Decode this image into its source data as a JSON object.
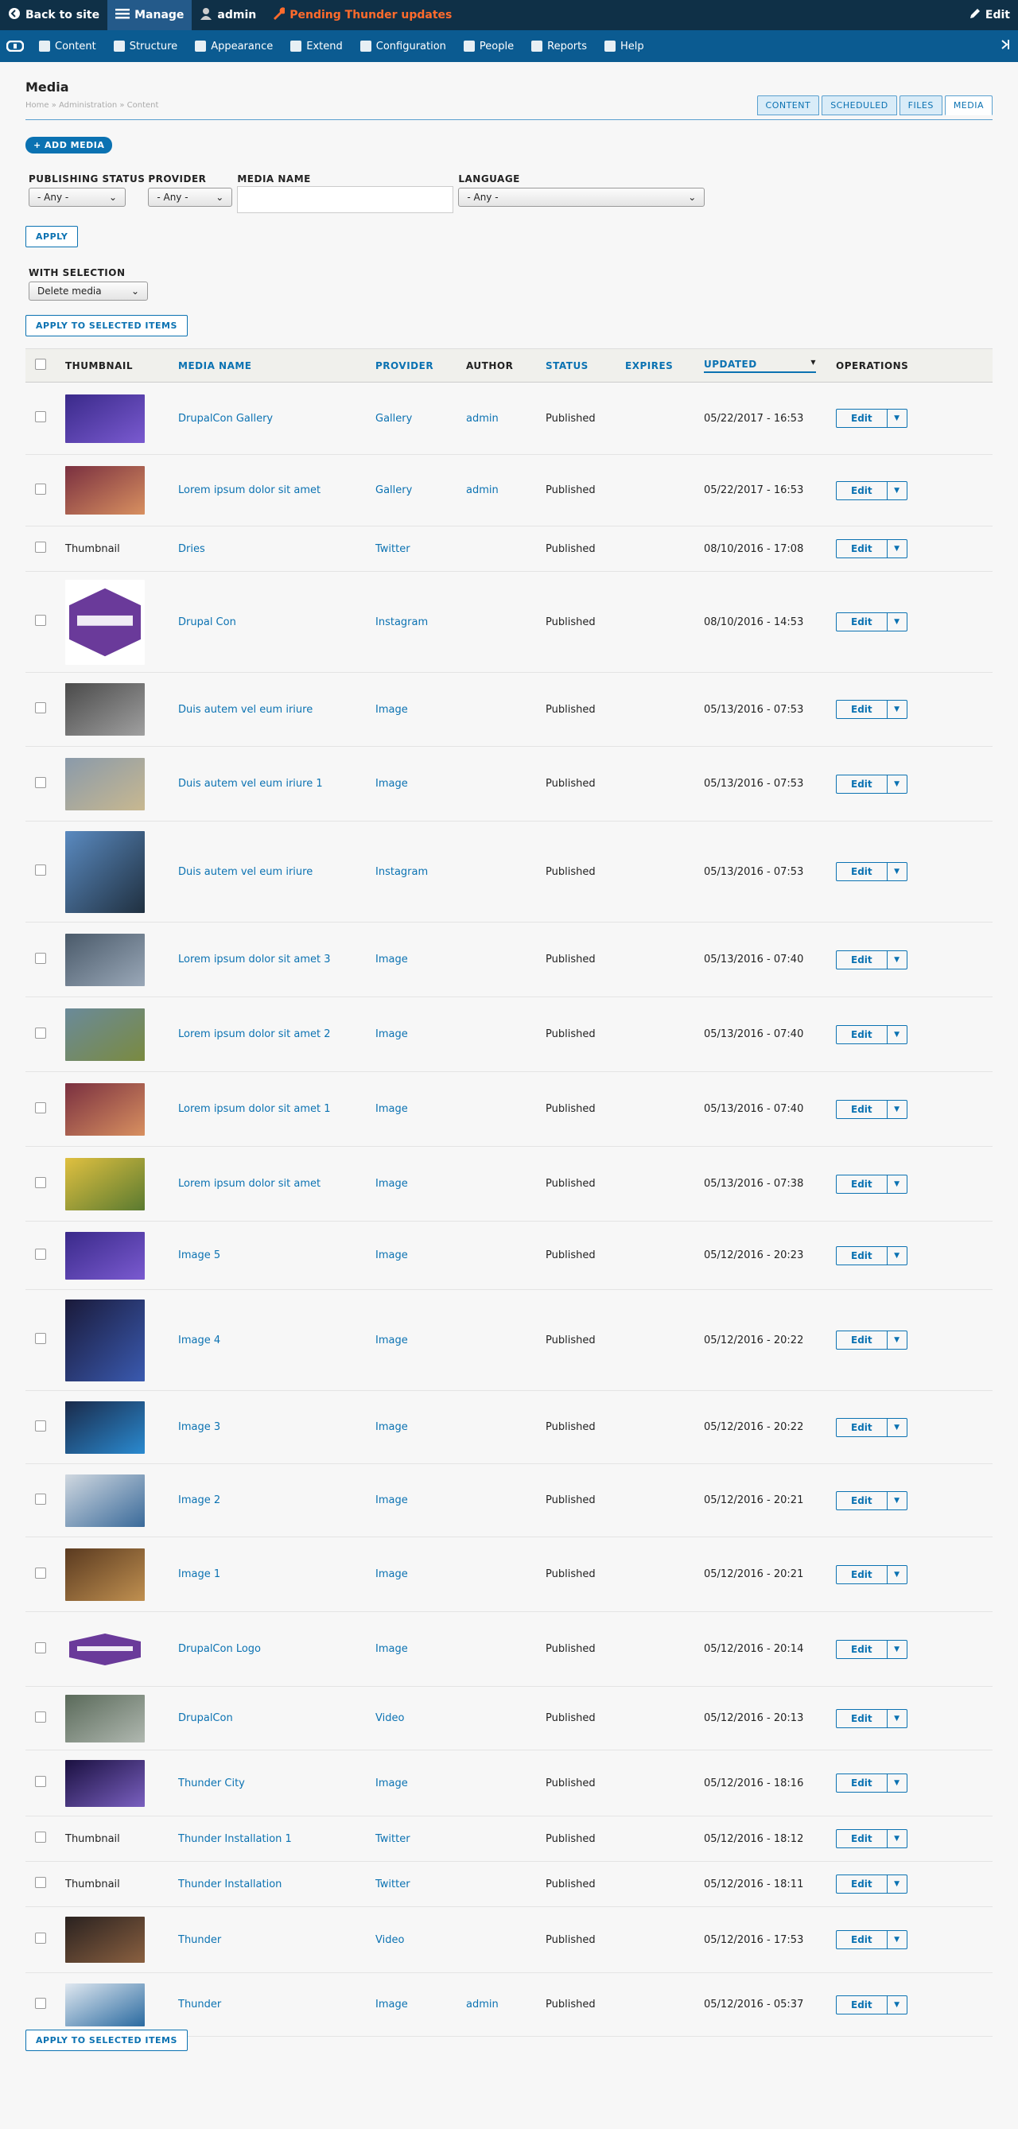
{
  "toolbar": {
    "back_label": "Back to site",
    "manage_label": "Manage",
    "user_label": "admin",
    "pending_label": "Pending Thunder updates",
    "edit_label": "Edit"
  },
  "admin_menu": {
    "items": [
      {
        "label": "Content",
        "icon": "content-icon"
      },
      {
        "label": "Structure",
        "icon": "structure-icon"
      },
      {
        "label": "Appearance",
        "icon": "appearance-icon"
      },
      {
        "label": "Extend",
        "icon": "extend-icon"
      },
      {
        "label": "Configuration",
        "icon": "configuration-icon"
      },
      {
        "label": "People",
        "icon": "people-icon"
      },
      {
        "label": "Reports",
        "icon": "reports-icon"
      },
      {
        "label": "Help",
        "icon": "help-icon"
      }
    ]
  },
  "page": {
    "title": "Media",
    "breadcrumb": "Home » Administration » Content",
    "tabs": [
      "CONTENT",
      "SCHEDULED",
      "FILES",
      "MEDIA"
    ],
    "active_tab": "MEDIA",
    "add_button": "+ ADD MEDIA"
  },
  "filters": {
    "publishing_status": {
      "label": "PUBLISHING STATUS",
      "value": "- Any -"
    },
    "provider": {
      "label": "PROVIDER",
      "value": "- Any -"
    },
    "media_name": {
      "label": "MEDIA NAME",
      "value": ""
    },
    "language": {
      "label": "LANGUAGE",
      "value": "- Any -"
    },
    "apply_label": "APPLY"
  },
  "bulk": {
    "label": "WITH SELECTION",
    "action": "Delete media",
    "apply_label": "APPLY TO SELECTED ITEMS"
  },
  "table": {
    "headers": {
      "thumbnail": "THUMBNAIL",
      "name": "MEDIA NAME",
      "provider": "PROVIDER",
      "author": "AUTHOR",
      "status": "STATUS",
      "expires": "EXPIRES",
      "updated": "UPDATED",
      "operations": "OPERATIONS"
    },
    "edit_label": "Edit",
    "rows": [
      {
        "thumb": "image",
        "thumb_text": "",
        "colors": [
          "#3a2a8a",
          "#7a5ad0"
        ],
        "name": "DrupalCon Gallery",
        "provider": "Gallery",
        "author": "admin",
        "status": "Published",
        "updated": "05/22/2017 - 16:53"
      },
      {
        "thumb": "image",
        "thumb_text": "",
        "colors": [
          "#7a3040",
          "#d89060"
        ],
        "name": "Lorem ipsum dolor sit amet",
        "provider": "Gallery",
        "author": "admin",
        "status": "Published",
        "updated": "05/22/2017 - 16:53"
      },
      {
        "thumb": "text",
        "thumb_text": "Thumbnail",
        "colors": [],
        "name": "Dries",
        "provider": "Twitter",
        "author": "",
        "status": "Published",
        "updated": "08/10/2016 - 17:08"
      },
      {
        "thumb": "logo",
        "thumb_text": "",
        "colors": [
          "#ffffff",
          "#6a3a9a"
        ],
        "name": "Drupal Con",
        "provider": "Instagram",
        "author": "",
        "status": "Published",
        "updated": "08/10/2016 - 14:53"
      },
      {
        "thumb": "image",
        "thumb_text": "",
        "colors": [
          "#4a4a4a",
          "#a0a0a0"
        ],
        "name": "Duis autem vel eum iriure",
        "provider": "Image",
        "author": "",
        "status": "Published",
        "updated": "05/13/2016 - 07:53"
      },
      {
        "thumb": "image",
        "thumb_text": "",
        "colors": [
          "#8a9aaa",
          "#c8b890"
        ],
        "name": "Duis autem vel eum iriure 1",
        "provider": "Image",
        "author": "",
        "status": "Published",
        "updated": "05/13/2016 - 07:53"
      },
      {
        "thumb": "image",
        "thumb_text": "",
        "colors": [
          "#5a8ac0",
          "#203040"
        ],
        "name": "Duis autem vel eum iriure",
        "provider": "Instagram",
        "author": "",
        "status": "Published",
        "updated": "05/13/2016 - 07:53"
      },
      {
        "thumb": "image",
        "thumb_text": "",
        "colors": [
          "#4a5a6a",
          "#9aa8b8"
        ],
        "name": "Lorem ipsum dolor sit amet 3",
        "provider": "Image",
        "author": "",
        "status": "Published",
        "updated": "05/13/2016 - 07:40"
      },
      {
        "thumb": "image",
        "thumb_text": "",
        "colors": [
          "#6a8a9a",
          "#7a8a40"
        ],
        "name": "Lorem ipsum dolor sit amet 2",
        "provider": "Image",
        "author": "",
        "status": "Published",
        "updated": "05/13/2016 - 07:40"
      },
      {
        "thumb": "image",
        "thumb_text": "",
        "colors": [
          "#7a3040",
          "#d89060"
        ],
        "name": "Lorem ipsum dolor sit amet 1",
        "provider": "Image",
        "author": "",
        "status": "Published",
        "updated": "05/13/2016 - 07:40"
      },
      {
        "thumb": "image",
        "thumb_text": "",
        "colors": [
          "#e0c040",
          "#5a7a30"
        ],
        "name": "Lorem ipsum dolor sit amet",
        "provider": "Image",
        "author": "",
        "status": "Published",
        "updated": "05/13/2016 - 07:38"
      },
      {
        "thumb": "image",
        "thumb_text": "",
        "colors": [
          "#3a2a8a",
          "#7a5ad0"
        ],
        "name": "Image 5",
        "provider": "Image",
        "author": "",
        "status": "Published",
        "updated": "05/12/2016 - 20:23"
      },
      {
        "thumb": "image",
        "thumb_text": "",
        "colors": [
          "#1a1a3a",
          "#3a5ab0"
        ],
        "name": "Image 4",
        "provider": "Image",
        "author": "",
        "status": "Published",
        "updated": "05/12/2016 - 20:22"
      },
      {
        "thumb": "image",
        "thumb_text": "",
        "colors": [
          "#1a2a4a",
          "#2a8ad0"
        ],
        "name": "Image 3",
        "provider": "Image",
        "author": "",
        "status": "Published",
        "updated": "05/12/2016 - 20:22"
      },
      {
        "thumb": "image",
        "thumb_text": "",
        "colors": [
          "#d0d8e0",
          "#3a6a9a"
        ],
        "name": "Image 2",
        "provider": "Image",
        "author": "",
        "status": "Published",
        "updated": "05/12/2016 - 20:21"
      },
      {
        "thumb": "image",
        "thumb_text": "",
        "colors": [
          "#5a3a20",
          "#c09050"
        ],
        "name": "Image 1",
        "provider": "Image",
        "author": "",
        "status": "Published",
        "updated": "05/12/2016 - 20:21"
      },
      {
        "thumb": "logo",
        "thumb_text": "",
        "colors": [
          "#f7f7f7",
          "#6a3a9a"
        ],
        "name": "DrupalCon Logo",
        "provider": "Image",
        "author": "",
        "status": "Published",
        "updated": "05/12/2016 - 20:14"
      },
      {
        "thumb": "image",
        "thumb_text": "",
        "colors": [
          "#5a6a5a",
          "#b0b8b0"
        ],
        "name": "DrupalCon",
        "provider": "Video",
        "author": "",
        "status": "Published",
        "updated": "05/12/2016 - 20:13"
      },
      {
        "thumb": "image",
        "thumb_text": "",
        "colors": [
          "#1a1040",
          "#7a60c0"
        ],
        "name": "Thunder City",
        "provider": "Image",
        "author": "",
        "status": "Published",
        "updated": "05/12/2016 - 18:16"
      },
      {
        "thumb": "text",
        "thumb_text": "Thumbnail",
        "colors": [],
        "name": "Thunder Installation 1",
        "provider": "Twitter",
        "author": "",
        "status": "Published",
        "updated": "05/12/2016 - 18:12"
      },
      {
        "thumb": "text",
        "thumb_text": "Thumbnail",
        "colors": [],
        "name": "Thunder Installation",
        "provider": "Twitter",
        "author": "",
        "status": "Published",
        "updated": "05/12/2016 - 18:11"
      },
      {
        "thumb": "image",
        "thumb_text": "",
        "colors": [
          "#2a2220",
          "#8a6040"
        ],
        "name": "Thunder",
        "provider": "Video",
        "author": "",
        "status": "Published",
        "updated": "05/12/2016 - 17:53"
      },
      {
        "thumb": "image",
        "thumb_text": "",
        "colors": [
          "#e0e8f0",
          "#2a6aa0"
        ],
        "name": "Thunder",
        "provider": "Image",
        "author": "admin",
        "status": "Published",
        "updated": "05/12/2016 - 05:37"
      }
    ]
  },
  "colors": {
    "accent": "#0b72b2",
    "toolbar": "#0f3047",
    "menu": "#0b5b91",
    "pending": "#ff6b2c"
  }
}
